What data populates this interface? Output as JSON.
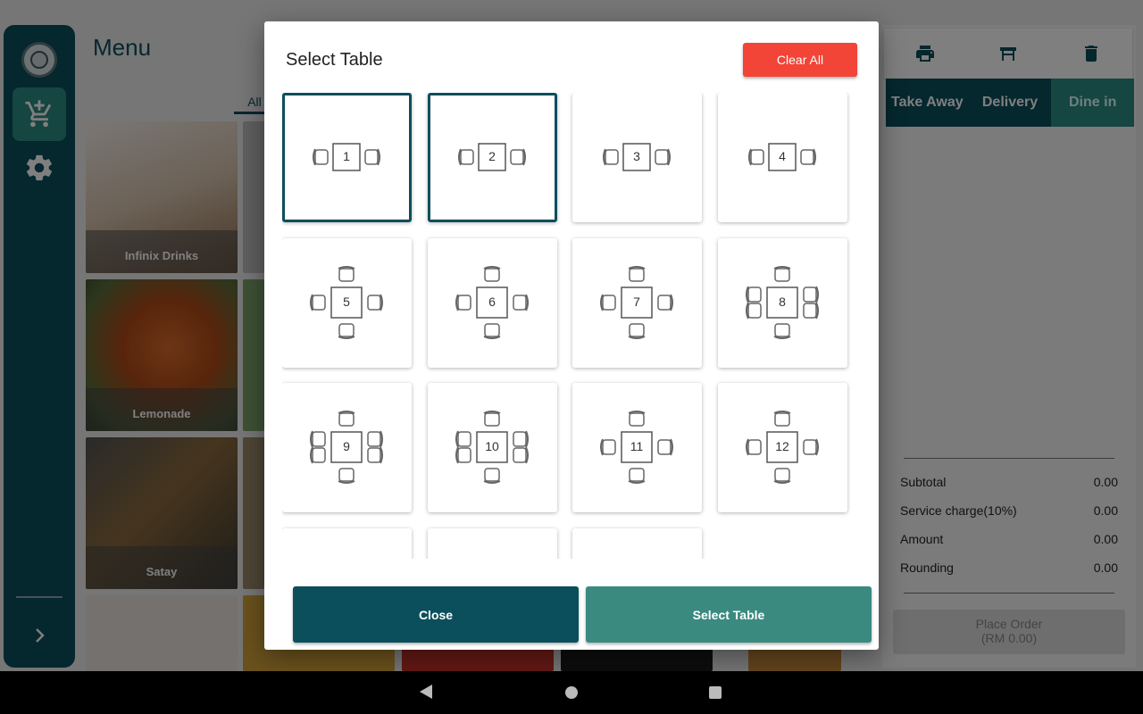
{
  "menu": {
    "title": "Menu",
    "category_tab": "All",
    "items": [
      {
        "label": "Infinix Drinks"
      },
      {
        "label": "Lemonade"
      },
      {
        "label": "Satay"
      }
    ]
  },
  "order": {
    "tabs": [
      "Take Away",
      "Delivery",
      "Dine in"
    ],
    "active_tab": "Dine in",
    "summary": [
      {
        "label": "Subtotal",
        "value": "0.00"
      },
      {
        "label": "Service charge(10%)",
        "value": "0.00"
      },
      {
        "label": "Amount",
        "value": "0.00"
      },
      {
        "label": "Rounding",
        "value": "0.00"
      }
    ],
    "place_order_label": "Place Order",
    "place_order_amount": "(RM 0.00)"
  },
  "dialog": {
    "title": "Select Table",
    "clear_label": "Clear All",
    "close_label": "Close",
    "select_label": "Select Table",
    "tables": [
      {
        "number": "1",
        "seats": 2,
        "selected": true
      },
      {
        "number": "2",
        "seats": 2,
        "selected": true
      },
      {
        "number": "3",
        "seats": 2,
        "selected": false
      },
      {
        "number": "4",
        "seats": 2,
        "selected": false
      },
      {
        "number": "5",
        "seats": 4,
        "selected": false
      },
      {
        "number": "6",
        "seats": 4,
        "selected": false
      },
      {
        "number": "7",
        "seats": 4,
        "selected": false
      },
      {
        "number": "8",
        "seats": 6,
        "selected": false
      },
      {
        "number": "9",
        "seats": 6,
        "selected": false
      },
      {
        "number": "10",
        "seats": 6,
        "selected": false
      },
      {
        "number": "11",
        "seats": 4,
        "selected": false
      },
      {
        "number": "12",
        "seats": 4,
        "selected": false
      },
      {
        "number": "",
        "seats": 0,
        "selected": false
      },
      {
        "number": "",
        "seats": 0,
        "selected": false
      },
      {
        "number": "",
        "seats": 0,
        "selected": false
      }
    ]
  },
  "colors": {
    "primary": "#0b4f5c",
    "accent": "#2b8c82",
    "danger": "#f24437"
  }
}
